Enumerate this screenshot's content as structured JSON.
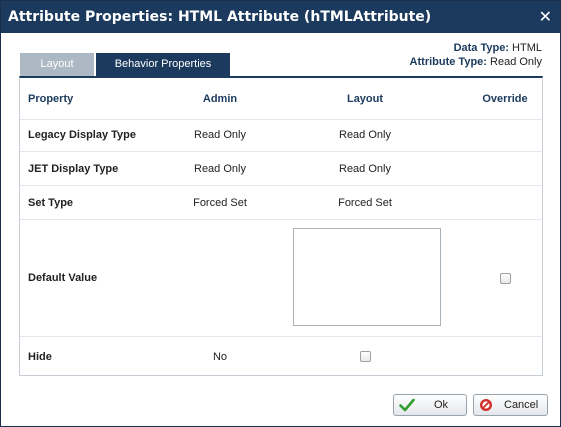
{
  "dialog": {
    "title": "Attribute Properties: HTML Attribute (hTMLAttribute)",
    "close_glyph": "✕"
  },
  "tabs": [
    {
      "label": "Layout",
      "active": false
    },
    {
      "label": "Behavior Properties",
      "active": true
    }
  ],
  "meta": {
    "data_type_label": "Data Type:",
    "data_type_value": "HTML",
    "attribute_type_label": "Attribute Type:",
    "attribute_type_value": "Read Only"
  },
  "table": {
    "headers": {
      "property": "Property",
      "admin": "Admin",
      "layout": "Layout",
      "override": "Override"
    },
    "rows": [
      {
        "property": "Legacy Display Type",
        "admin": "Read Only",
        "layout": "Read Only"
      },
      {
        "property": "JET Display Type",
        "admin": "Read Only",
        "layout": "Read Only"
      },
      {
        "property": "Set Type",
        "admin": "Forced Set",
        "layout": "Forced Set"
      },
      {
        "property": "Default Value",
        "admin": "",
        "layout": "",
        "override_checked": false
      },
      {
        "property": "Hide",
        "admin": "No",
        "layout_checked": false
      }
    ]
  },
  "buttons": {
    "ok_label": "Ok",
    "cancel_label": "Cancel"
  },
  "colors": {
    "accent": "#1b3a5d",
    "inactive_tab": "#adb8c5",
    "ok_icon": "#2e9e2e",
    "cancel_icon": "#d0302a"
  }
}
